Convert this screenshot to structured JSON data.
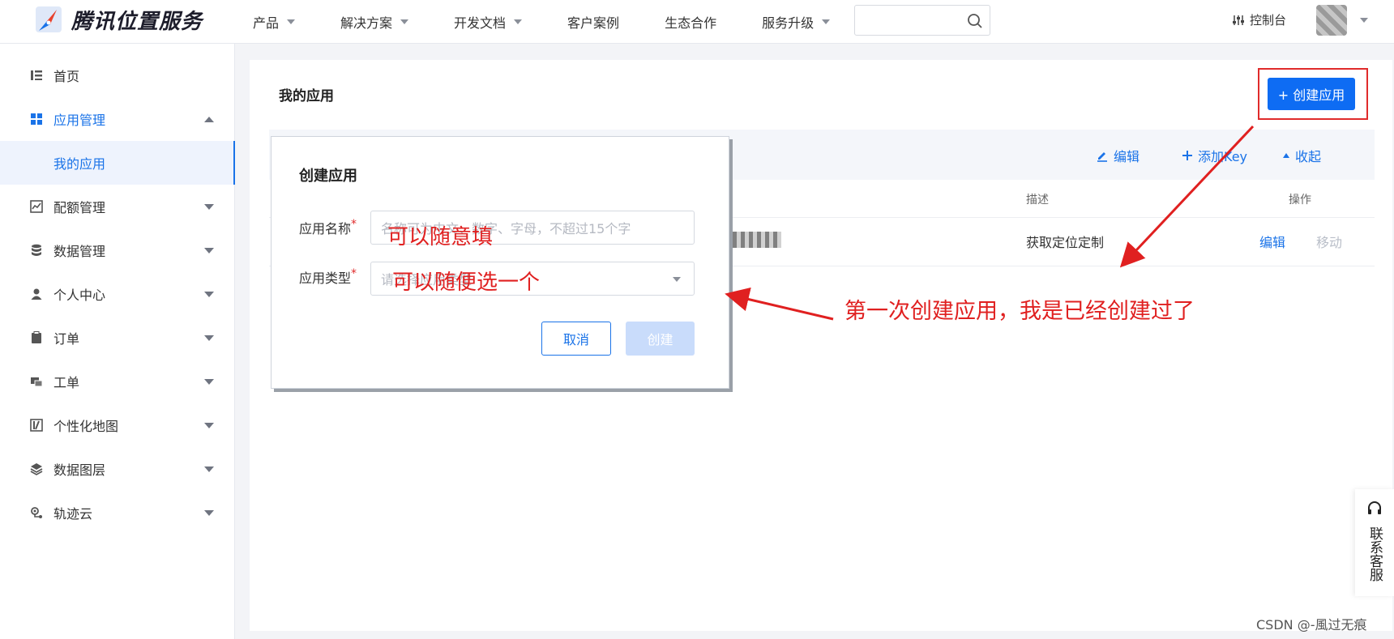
{
  "header": {
    "brand": "腾讯位置服务",
    "nav": [
      {
        "label": "产品",
        "dropdown": true
      },
      {
        "label": "解决方案",
        "dropdown": true
      },
      {
        "label": "开发文档",
        "dropdown": true
      },
      {
        "label": "客户案例",
        "dropdown": false
      },
      {
        "label": "生态合作",
        "dropdown": false
      },
      {
        "label": "服务升级",
        "dropdown": true
      }
    ],
    "search_value": "",
    "console_label": "控制台"
  },
  "sidebar": {
    "items": [
      {
        "label": "首页"
      },
      {
        "label": "应用管理"
      },
      {
        "label": "我的应用"
      },
      {
        "label": "配额管理"
      },
      {
        "label": "数据管理"
      },
      {
        "label": "个人中心"
      },
      {
        "label": "订单"
      },
      {
        "label": "工单"
      },
      {
        "label": "个性化地图"
      },
      {
        "label": "数据图层"
      },
      {
        "label": "轨迹云"
      }
    ]
  },
  "main": {
    "title": "我的应用",
    "create_button": "+ 创建应用",
    "card_actions": {
      "edit": "编辑",
      "add_key": "添加Key",
      "collapse": "收起"
    },
    "columns": {
      "desc": "描述",
      "ops": "操作"
    },
    "row": {
      "desc": "获取定位定制",
      "edit": "编辑",
      "move": "移动"
    }
  },
  "dialog": {
    "title": "创建应用",
    "name_label": "应用名称",
    "name_placeholder": "名称可为中文、数字、字母，不超过15个字",
    "type_label": "应用类型",
    "type_placeholder": "请选择应用类型",
    "required_mark": "*",
    "cancel": "取消",
    "create": "创建"
  },
  "annotations": {
    "name_hint": "可以随意填",
    "type_hint": "可以随便选一个",
    "main_note": "第一次创建应用，我是已经创建过了"
  },
  "service": {
    "label": "联系客服"
  },
  "watermark": "CSDN @-風过无痕"
}
